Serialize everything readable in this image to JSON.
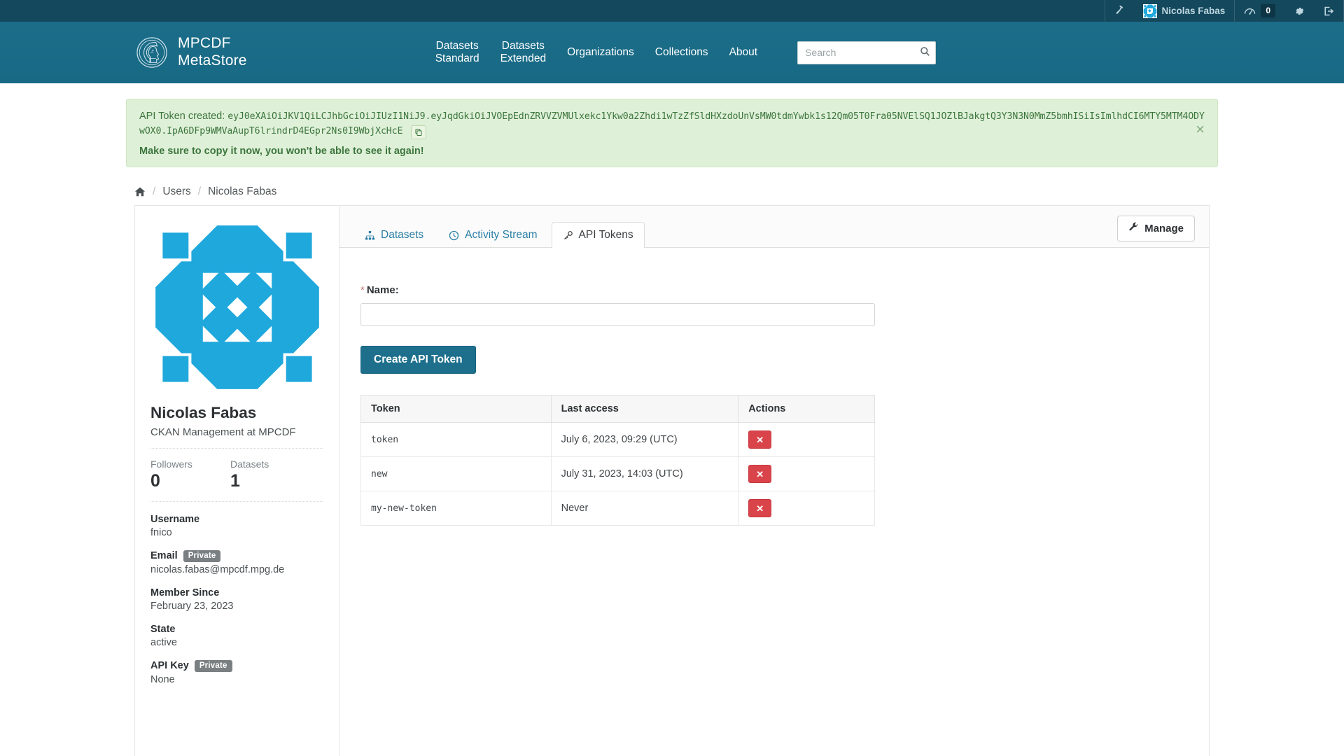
{
  "account_bar": {
    "sysadmin_icon": "hammer-icon",
    "username": "Nicolas Fabas",
    "avatar_icon": "user-avatar-identicon",
    "dashboard_icon": "dashboard-icon",
    "notification_count": "0",
    "settings_icon": "gear-icon",
    "logout_icon": "logout-icon"
  },
  "header": {
    "logo_icon": "minerva-head-logo",
    "brand_line1": "MPCDF",
    "brand_line2": "MetaStore",
    "nav": [
      {
        "label": "Datasets\nStandard",
        "name": "nav-datasets-standard"
      },
      {
        "label": "Datasets\nExtended",
        "name": "nav-datasets-extended"
      },
      {
        "label": "Organizations",
        "name": "nav-organizations"
      },
      {
        "label": "Collections",
        "name": "nav-collections"
      },
      {
        "label": "About",
        "name": "nav-about"
      }
    ],
    "search": {
      "placeholder": "Search",
      "value": "",
      "icon": "search-icon"
    }
  },
  "alert": {
    "label": "API Token created:",
    "token": "eyJ0eXAiOiJKV1QiLCJhbGciOiJIUzI1NiJ9.eyJqdGkiOiJVOEpEdnZRVVZVMUlxekc1Ykw0a2Zhdi1wTzZfSldHXzdoUnVsMW0tdmYwbk1s12Qm05T0Fra05NVElSQ1JOZlBJakgtQ3Y3N3N0MmZ5bmhISiIsImlhdCI6MTY5MTM4ODYwOX0.IpA6DFp9WMVaAupT6lrindrD4EGpr2Ns0I9WbjXcHcE",
    "copy_icon": "copy-icon",
    "warning": "Make sure to copy it now, you won't be able to see it again!",
    "close_icon": "close-icon",
    "bg_color": "#dff0d8",
    "text_color": "#3c763d"
  },
  "breadcrumb": {
    "home_icon": "home-icon",
    "items": [
      {
        "label": "Users",
        "name": "breadcrumb-users"
      },
      {
        "label": "Nicolas Fabas",
        "name": "breadcrumb-nicolas-fabas"
      }
    ],
    "separator": "/"
  },
  "sidebar": {
    "avatar_icon": "user-avatar-identicon",
    "avatar_color": "#1fa8dc",
    "display_name": "Nicolas Fabas",
    "about": "CKAN Management at MPCDF",
    "stats": [
      {
        "label": "Followers",
        "value": "0"
      },
      {
        "label": "Datasets",
        "value": "1"
      }
    ],
    "fields": [
      {
        "label": "Username",
        "badge": "",
        "value": "fnico"
      },
      {
        "label": "Email",
        "badge": "Private",
        "value": "nicolas.fabas@mpcdf.mpg.de"
      },
      {
        "label": "Member Since",
        "badge": "",
        "value": "February 23, 2023"
      },
      {
        "label": "State",
        "badge": "",
        "value": "active"
      },
      {
        "label": "API Key",
        "badge": "Private",
        "value": "None"
      }
    ]
  },
  "main": {
    "tabs": [
      {
        "label": "Datasets",
        "icon": "sitemap-icon",
        "active": false,
        "name": "tab-datasets"
      },
      {
        "label": "Activity Stream",
        "icon": "clock-icon",
        "active": false,
        "name": "tab-activity-stream"
      },
      {
        "label": "API Tokens",
        "icon": "key-icon",
        "active": true,
        "name": "tab-api-tokens"
      }
    ],
    "manage_button": {
      "label": "Manage",
      "icon": "wrench-icon"
    },
    "form": {
      "required_marker": "*",
      "name_label": "Name:",
      "name_value": "",
      "name_placeholder": "",
      "create_button": "Create API Token"
    },
    "table": {
      "columns": [
        "Token",
        "Last access",
        "Actions"
      ],
      "rows": [
        {
          "token": "token",
          "last_access": "July 6, 2023, 09:29 (UTC)",
          "action_icon": "revoke-x-icon"
        },
        {
          "token": "new",
          "last_access": "July 31, 2023, 14:03 (UTC)",
          "action_icon": "revoke-x-icon"
        },
        {
          "token": "my-new-token",
          "last_access": "Never",
          "action_icon": "revoke-x-icon"
        }
      ]
    }
  },
  "colors": {
    "masthead": "#14485c",
    "header": "#186b87",
    "primary_button": "#1d6f8c",
    "danger": "#d9444a",
    "link": "#2a7ea5"
  }
}
